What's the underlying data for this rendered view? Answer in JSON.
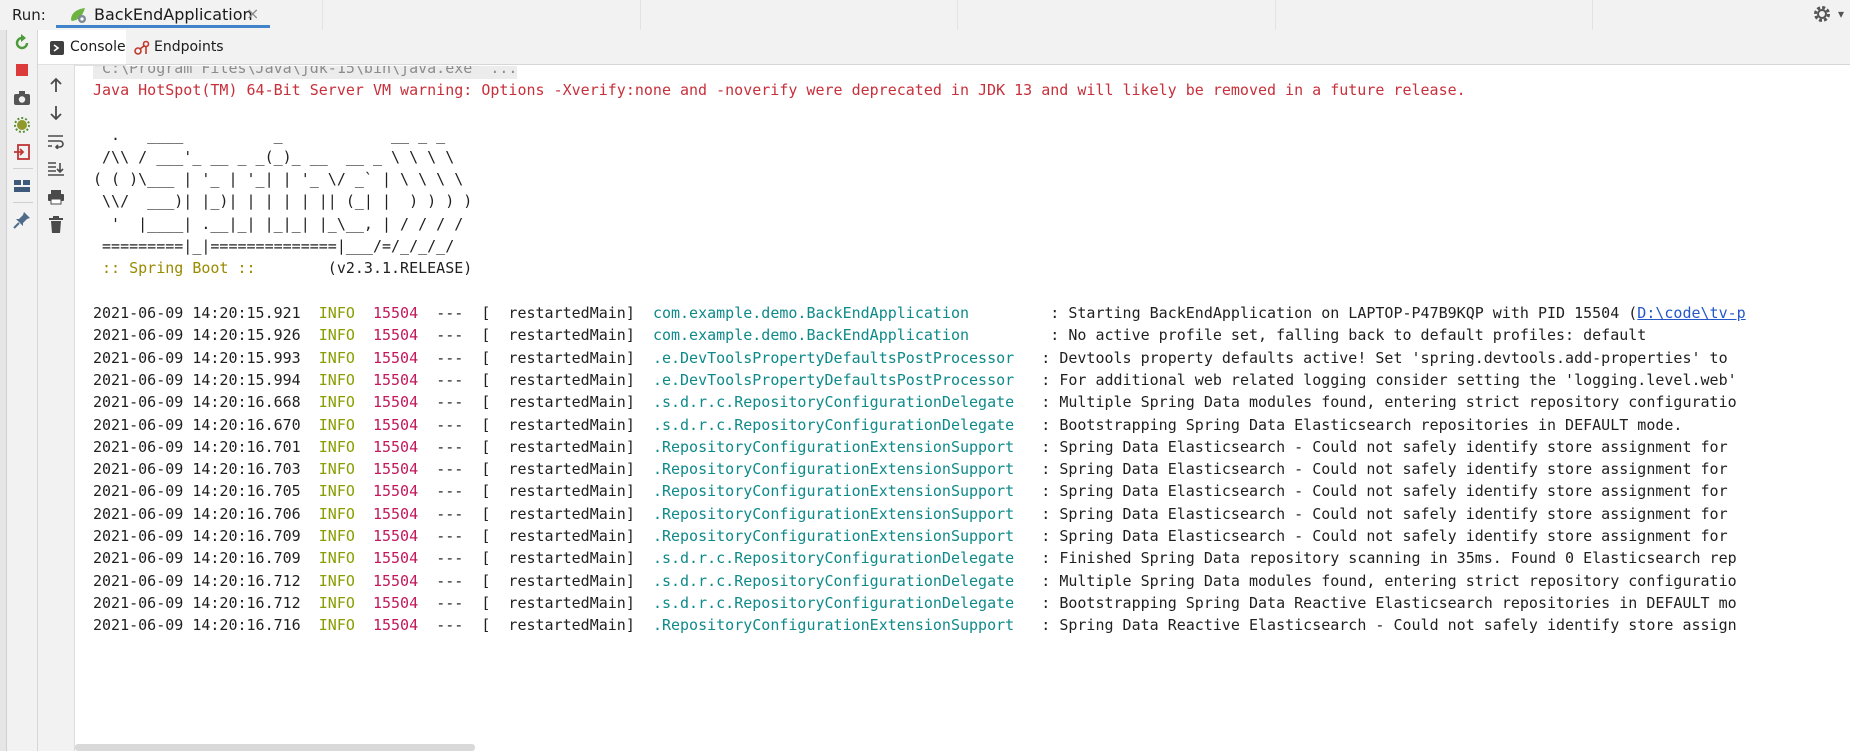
{
  "runbar": {
    "label": "Run:",
    "tab_title": "BackEndApplication",
    "tab_close": "×",
    "more": "▾"
  },
  "tabs": [
    {
      "label": "Console",
      "icon": "console-icon"
    },
    {
      "label": "Endpoints",
      "icon": "endpoints-icon"
    }
  ],
  "console": {
    "command": "\"C:\\Program Files\\Java\\jdk-15\\bin\\java.exe\" ...",
    "warning": "Java HotSpot(TM) 64-Bit Server VM warning: Options -Xverify:none and -noverify were deprecated in JDK 13 and will likely be removed in a future release.",
    "banner": [
      "  .   ____          _            __ _ _",
      " /\\\\ / ___'_ __ _ _(_)_ __  __ _ \\ \\ \\ \\",
      "( ( )\\___ | '_ | '_| | '_ \\/ _` | \\ \\ \\ \\",
      " \\\\/  ___)| |_)| | | | | || (_| |  ) ) ) )",
      "  '  |____| .__|_| |_|_| |_\\__, | / / / /",
      " =========|_|==============|___/=/_/_/_/"
    ],
    "boot_label": " :: Spring Boot :: ",
    "boot_version": "       (v2.3.1.RELEASE)",
    "logs": [
      {
        "ts": "2021-06-09 14:20:15.921",
        "level": "INFO",
        "pid": "15504",
        "thread": "---  [  restartedMain]",
        "logger": "com.example.demo.BackEndApplication      ",
        "msg": " : Starting BackEndApplication on LAPTOP-P47B9KQP with PID 15504 (",
        "link": "D:\\code\\tv-p"
      },
      {
        "ts": "2021-06-09 14:20:15.926",
        "level": "INFO",
        "pid": "15504",
        "thread": "---  [  restartedMain]",
        "logger": "com.example.demo.BackEndApplication      ",
        "msg": " : No active profile set, falling back to default profiles: default"
      },
      {
        "ts": "2021-06-09 14:20:15.993",
        "level": "INFO",
        "pid": "15504",
        "thread": "---  [  restartedMain]",
        "logger": ".e.DevToolsPropertyDefaultsPostProcessor",
        "msg": " : Devtools property defaults active! Set 'spring.devtools.add-properties' to"
      },
      {
        "ts": "2021-06-09 14:20:15.994",
        "level": "INFO",
        "pid": "15504",
        "thread": "---  [  restartedMain]",
        "logger": ".e.DevToolsPropertyDefaultsPostProcessor",
        "msg": " : For additional web related logging consider setting the 'logging.level.web'"
      },
      {
        "ts": "2021-06-09 14:20:16.668",
        "level": "INFO",
        "pid": "15504",
        "thread": "---  [  restartedMain]",
        "logger": ".s.d.r.c.RepositoryConfigurationDelegate",
        "msg": " : Multiple Spring Data modules found, entering strict repository configuratio"
      },
      {
        "ts": "2021-06-09 14:20:16.670",
        "level": "INFO",
        "pid": "15504",
        "thread": "---  [  restartedMain]",
        "logger": ".s.d.r.c.RepositoryConfigurationDelegate",
        "msg": " : Bootstrapping Spring Data Elasticsearch repositories in DEFAULT mode."
      },
      {
        "ts": "2021-06-09 14:20:16.701",
        "level": "INFO",
        "pid": "15504",
        "thread": "---  [  restartedMain]",
        "logger": ".RepositoryConfigurationExtensionSupport",
        "msg": " : Spring Data Elasticsearch - Could not safely identify store assignment for"
      },
      {
        "ts": "2021-06-09 14:20:16.703",
        "level": "INFO",
        "pid": "15504",
        "thread": "---  [  restartedMain]",
        "logger": ".RepositoryConfigurationExtensionSupport",
        "msg": " : Spring Data Elasticsearch - Could not safely identify store assignment for"
      },
      {
        "ts": "2021-06-09 14:20:16.705",
        "level": "INFO",
        "pid": "15504",
        "thread": "---  [  restartedMain]",
        "logger": ".RepositoryConfigurationExtensionSupport",
        "msg": " : Spring Data Elasticsearch - Could not safely identify store assignment for"
      },
      {
        "ts": "2021-06-09 14:20:16.706",
        "level": "INFO",
        "pid": "15504",
        "thread": "---  [  restartedMain]",
        "logger": ".RepositoryConfigurationExtensionSupport",
        "msg": " : Spring Data Elasticsearch - Could not safely identify store assignment for"
      },
      {
        "ts": "2021-06-09 14:20:16.709",
        "level": "INFO",
        "pid": "15504",
        "thread": "---  [  restartedMain]",
        "logger": ".RepositoryConfigurationExtensionSupport",
        "msg": " : Spring Data Elasticsearch - Could not safely identify store assignment for"
      },
      {
        "ts": "2021-06-09 14:20:16.709",
        "level": "INFO",
        "pid": "15504",
        "thread": "---  [  restartedMain]",
        "logger": ".s.d.r.c.RepositoryConfigurationDelegate",
        "msg": " : Finished Spring Data repository scanning in 35ms. Found 0 Elasticsearch rep"
      },
      {
        "ts": "2021-06-09 14:20:16.712",
        "level": "INFO",
        "pid": "15504",
        "thread": "---  [  restartedMain]",
        "logger": ".s.d.r.c.RepositoryConfigurationDelegate",
        "msg": " : Multiple Spring Data modules found, entering strict repository configuratio"
      },
      {
        "ts": "2021-06-09 14:20:16.712",
        "level": "INFO",
        "pid": "15504",
        "thread": "---  [  restartedMain]",
        "logger": ".s.d.r.c.RepositoryConfigurationDelegate",
        "msg": " : Bootstrapping Spring Data Reactive Elasticsearch repositories in DEFAULT mo"
      },
      {
        "ts": "2021-06-09 14:20:16.716",
        "level": "INFO",
        "pid": "15504",
        "thread": "---  [  restartedMain]",
        "logger": ".RepositoryConfigurationExtensionSupport",
        "msg": " : Spring Data Reactive Elasticsearch - Could not safely identify store assign"
      }
    ]
  }
}
